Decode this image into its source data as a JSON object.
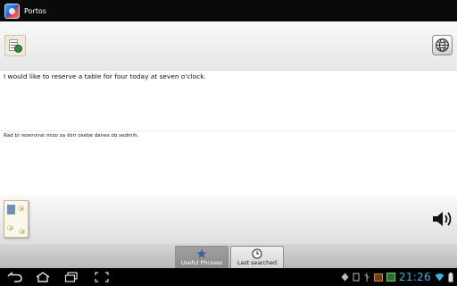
{
  "window": {
    "title": "Portos"
  },
  "toolbar": {
    "language_icon": "language-menu-icon",
    "globe_icon": "globe-icon"
  },
  "source": {
    "text": "I would like to reserve a table for four today at seven o'clock."
  },
  "translation": {
    "text": "Rad bi rezerviral mizo za štiri osebe danes ob sedmih."
  },
  "bottom": {
    "menu_icon": "restaurant-menu-icon",
    "speaker_icon": "speaker-icon"
  },
  "tabs": [
    {
      "label": "Useful Phrases",
      "icon": "star-icon",
      "selected": true
    },
    {
      "label": "Last searched",
      "icon": "clock-icon",
      "selected": false
    }
  ],
  "system": {
    "time": "21:26",
    "clock_color": "#33b5e5",
    "nav_icons": [
      "back-icon",
      "home-icon",
      "recent-apps-icon",
      "screenshot-icon"
    ],
    "status_icons": [
      "notification-icon",
      "notification-icon",
      "usb-icon",
      "notification-icon",
      "notification-icon",
      "wifi-icon",
      "battery-icon"
    ]
  }
}
